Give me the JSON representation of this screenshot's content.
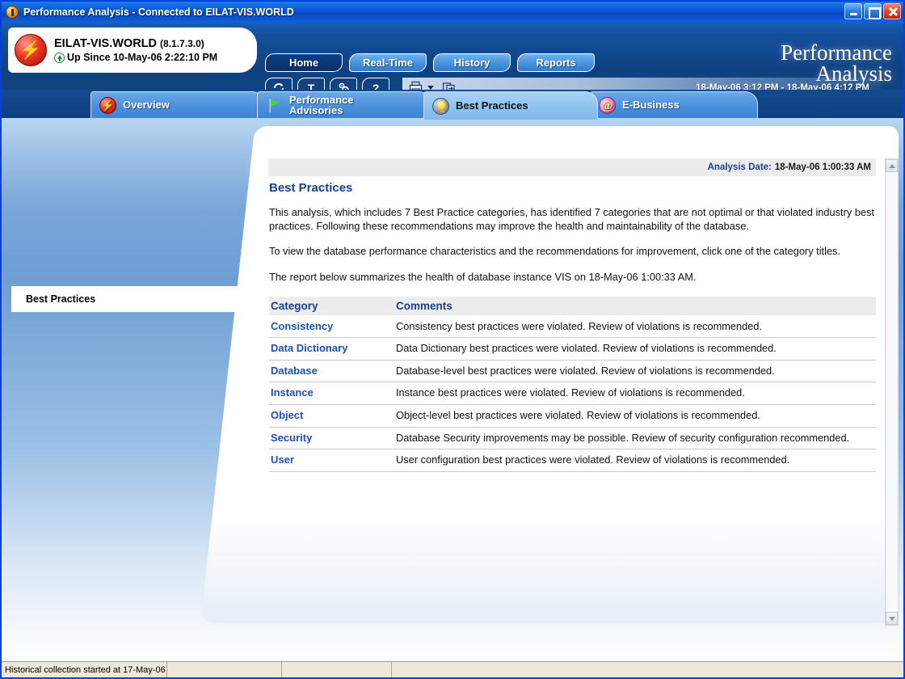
{
  "window": {
    "title": "Performance Analysis - Connected to EILAT-VIS.WORLD",
    "icon": "app-icon",
    "minimize_label": "Minimize",
    "maximize_label": "Maximize",
    "close_label": "Close"
  },
  "banner": {
    "connection": {
      "db_name": "EILAT-VIS.WORLD",
      "version": "(8.1.7.3.0)",
      "uptime": "Up Since 10-May-06 2:22:10 PM",
      "icon": "database-status-icon"
    },
    "nav": [
      {
        "label": "Home",
        "active": true
      },
      {
        "label": "Real-Time",
        "active": false
      },
      {
        "label": "History",
        "active": false
      },
      {
        "label": "Reports",
        "active": false
      }
    ],
    "toolbar": [
      {
        "name": "refresh-icon",
        "label": ""
      },
      {
        "name": "top-icon",
        "label": "T"
      },
      {
        "name": "settings-gear-icon",
        "label": ""
      },
      {
        "name": "help-icon",
        "label": "?"
      }
    ],
    "print_icon": "print-icon",
    "print_dropdown_icon": "caret-down-icon",
    "export_icon": "export-icon",
    "time_range": "18-May-06 3:12 PM - 18-May-06 4:12 PM",
    "brand_line1": "Performance",
    "brand_line2": "Analysis"
  },
  "tabs": [
    {
      "label": "Overview",
      "icon": "overview-icon",
      "active": false
    },
    {
      "label": "Performance\nAdvisories",
      "icon": "advisories-flag-icon",
      "active": false
    },
    {
      "label": "Best Practices",
      "icon": "lightbulb-icon",
      "active": true
    },
    {
      "label": "E-Business",
      "icon": "e-business-icon",
      "active": false
    }
  ],
  "left_panel": {
    "label": "Best Practices"
  },
  "analysis": {
    "date_label": "Analysis Date:",
    "date_value": "18-May-06 1:00:33 AM"
  },
  "main": {
    "heading": "Best Practices",
    "paragraph1": "This analysis, which includes 7 Best Practice categories, has identified 7 categories that are not optimal or that violated industry best practices. Following these recommendations may improve the health and maintainability of the database.",
    "paragraph2": "To view the database performance characteristics and the recommendations for improvement, click one of the category titles.",
    "paragraph3": "The report below summarizes the health of database instance VIS on 18-May-06 1:00:33 AM.",
    "table": {
      "columns": [
        "Category",
        "Comments"
      ],
      "rows": [
        {
          "category": "Consistency",
          "comment": "Consistency best practices were violated. Review of violations is recommended."
        },
        {
          "category": "Data Dictionary",
          "comment": "Data Dictionary best practices were violated. Review of violations is recommended."
        },
        {
          "category": "Database",
          "comment": "Database-level best practices were violated. Review of violations is recommended."
        },
        {
          "category": "Instance",
          "comment": "Instance best practices were violated. Review of violations is recommended."
        },
        {
          "category": "Object",
          "comment": "Object-level best practices were violated. Review of violations is recommended."
        },
        {
          "category": "Security",
          "comment": "Database Security improvements may be possible. Review of security configuration recommended."
        },
        {
          "category": "User",
          "comment": "User configuration best practices were violated. Review of violations is recommended."
        }
      ]
    }
  },
  "scrollbar": {
    "up_icon": "scroll-up-icon",
    "down_icon": "scroll-down-icon"
  },
  "statusbar": {
    "cells": [
      "Historical collection started at 17-May-06",
      "",
      "",
      ""
    ]
  },
  "colors": {
    "accent_blue": "#1b3f8f",
    "link_blue": "#1e4fb8",
    "banner_blue": "#0f4181",
    "active_tab": "#8dc2ef"
  }
}
